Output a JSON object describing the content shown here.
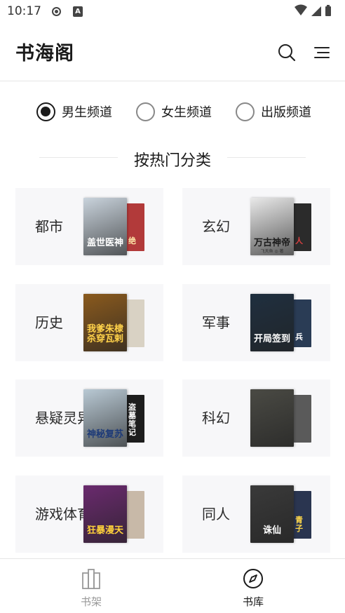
{
  "status_bar": {
    "time": "10:17",
    "badge_letter": "A"
  },
  "header": {
    "logo": "书海阁",
    "search_icon": "search-icon",
    "menu_icon": "menu-icon"
  },
  "channels": [
    {
      "label": "男生频道",
      "checked": true
    },
    {
      "label": "女生频道",
      "checked": false
    },
    {
      "label": "出版频道",
      "checked": false
    }
  ],
  "section": {
    "title": "按热门分类"
  },
  "categories": [
    {
      "label": "都市",
      "front_cover": {
        "title": "盖世医神",
        "color": "#c9d3dc",
        "text_color": "#ffffff"
      },
      "back_cover": {
        "title": "绝",
        "color": "#b23a3a",
        "text_color": "#ffe9a8"
      }
    },
    {
      "label": "玄幻",
      "front_cover": {
        "title": "万古神帝",
        "color": "#e9e9e9",
        "text_color": "#1a1a1a",
        "sub": "飞天鱼 ◎ 著"
      },
      "back_cover": {
        "title": "人",
        "color": "#2b2b2b",
        "text_color": "#d94040"
      }
    },
    {
      "label": "历史",
      "front_cover": {
        "title": "我爹朱棣 杀穿瓦剌",
        "color": "#8a5a1e",
        "text_color": "#ffd24a"
      },
      "back_cover": {
        "title": "",
        "color": "#d9d2c4",
        "text_color": "#333"
      }
    },
    {
      "label": "军事",
      "front_cover": {
        "title": "开局签到",
        "color": "#1f2f3f",
        "text_color": "#ffffff"
      },
      "back_cover": {
        "title": "兵",
        "color": "#2a3c55",
        "text_color": "#ffffff"
      }
    },
    {
      "label": "悬疑灵异",
      "front_cover": {
        "title": "神秘复苏",
        "color": "#b9c9d4",
        "text_color": "#1d3a78"
      },
      "back_cover": {
        "title": "盗墓笔记",
        "color": "#1d1d1d",
        "text_color": "#ffffff"
      }
    },
    {
      "label": "科幻",
      "front_cover": {
        "title": "",
        "color": "#4a4a44",
        "text_color": "#ffffff"
      },
      "back_cover": {
        "title": "",
        "color": "#5a5a5a",
        "text_color": "#ffffff"
      }
    },
    {
      "label": "游戏体育",
      "front_cover": {
        "title": "狂暴漫天",
        "color": "#6a2a6e",
        "text_color": "#ffd23a"
      },
      "back_cover": {
        "title": "",
        "color": "#c8b9a8",
        "text_color": "#333"
      }
    },
    {
      "label": "同人",
      "front_cover": {
        "title": "诛仙",
        "color": "#3a3a3a",
        "text_color": "#ffffff"
      },
      "back_cover": {
        "title": "青子",
        "color": "#2a3550",
        "text_color": "#ffd84a"
      }
    }
  ],
  "bottom_nav": [
    {
      "label": "书架",
      "icon": "bookshelf-icon",
      "active": false
    },
    {
      "label": "书库",
      "icon": "compass-icon",
      "active": true
    }
  ]
}
